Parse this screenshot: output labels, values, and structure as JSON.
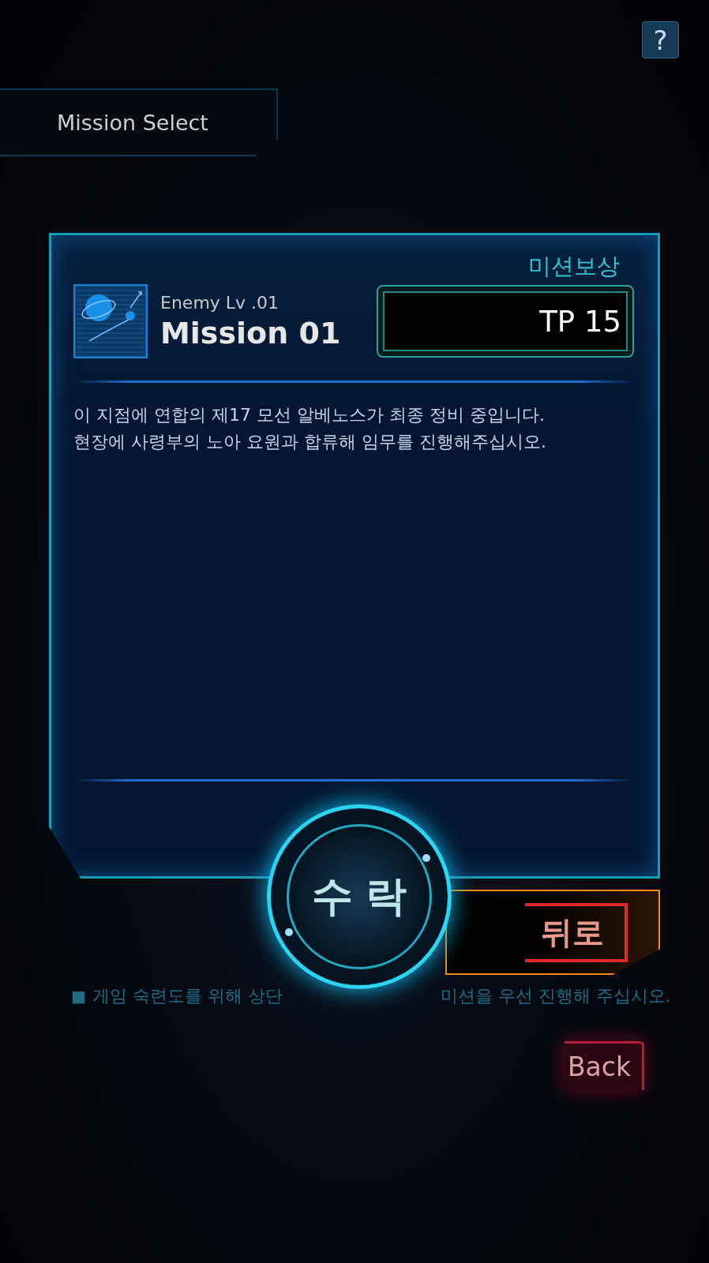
{
  "header": {
    "title": "Mission Select",
    "help": "?"
  },
  "mission": {
    "reward_label": "미션보상",
    "enemy_level": "Enemy Lv .01",
    "name": "Mission 01",
    "reward": "TP 15",
    "description": [
      "이 지점에 연합의 제17 모선 알베노스가 최종 정비 중입니다.",
      "현장에 사령부의 노아 요원과 합류해 임무를 진행해주십시오."
    ]
  },
  "buttons": [
    {
      "kind": "accept",
      "label": "수락"
    },
    {
      "kind": "back",
      "label": "뒤로"
    }
  ],
  "hint": {
    "marker": "■",
    "parts": [
      "게임 숙련도를 위해 상단",
      "미션을 우선 진행해 주십시오."
    ]
  },
  "back_button": {
    "label": "Back"
  }
}
